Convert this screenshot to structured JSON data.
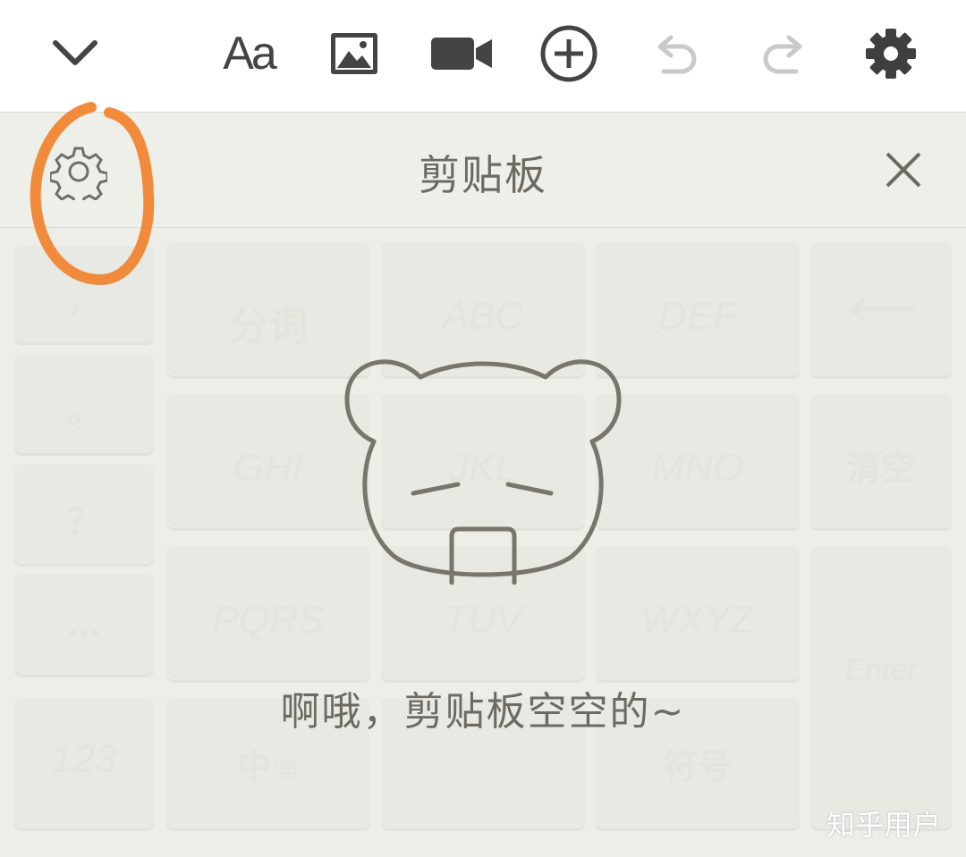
{
  "toolbar": {
    "icons": [
      "chevron-down-icon",
      "font-style-icon",
      "image-icon",
      "video-icon",
      "add-circle-icon",
      "undo-icon",
      "redo-icon",
      "settings-icon"
    ],
    "font_label": "Aa"
  },
  "clipboard": {
    "title": "剪贴板",
    "empty_message": "啊哦，剪贴板空空的~"
  },
  "keyboard": {
    "left_column": [
      "，",
      "。",
      "？",
      "…"
    ],
    "keys": [
      {
        "num": "1",
        "label": "分词"
      },
      {
        "num": "2",
        "label": "ABC"
      },
      {
        "num": "3",
        "label": "DEF"
      },
      {
        "num": "4",
        "label": "GHI"
      },
      {
        "num": "5",
        "label": "JKL"
      },
      {
        "num": "6",
        "label": "MNO"
      },
      {
        "num": "7",
        "label": "PQRS"
      },
      {
        "num": "8",
        "label": "TUV"
      },
      {
        "num": "9",
        "label": "WXYZ"
      }
    ],
    "right_column": {
      "clear": "清空",
      "enter": "Enter"
    },
    "bottom_row": {
      "num_mode": "123",
      "lang": "中",
      "lang_sub": "/英",
      "symbol": "符号"
    }
  },
  "watermark": "知乎用户",
  "colors": {
    "annotation": "#f28a3c",
    "icon_dark": "#444444",
    "icon_disabled": "#c9c9c9",
    "bear": "#76766c"
  }
}
